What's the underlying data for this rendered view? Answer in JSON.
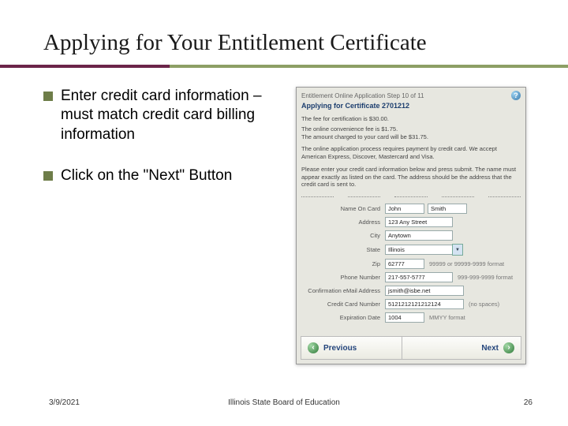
{
  "title": "Applying for Your Entitlement Certificate",
  "bullets": [
    "Enter credit card information – must match credit card billing information",
    "Click on the \"Next\" Button"
  ],
  "footer": {
    "date": "3/9/2021",
    "org": "Illinois State Board of Education",
    "page": "26"
  },
  "shot": {
    "step": "Entitlement Online Application Step 10 of 11",
    "heading": "Applying for Certificate 2701212",
    "fee1": "The fee for certification is $30.00.",
    "fee2": "The online convenience fee is $1.75.",
    "fee3": "The amount charged to your card will be $31.75.",
    "para1": "The online application process requires payment by credit card. We accept American Express, Discover, Mastercard and Visa.",
    "para2": "Please enter your credit card information below and press submit. The name must appear exactly as listed on the card. The address should be the address that the credit card is sent to.",
    "labels": {
      "name": "Name On Card",
      "address": "Address",
      "city": "City",
      "state": "State",
      "zip": "Zip",
      "phone": "Phone Number",
      "email": "Confirmation eMail Address",
      "card": "Credit Card Number",
      "exp": "Expiration Date"
    },
    "values": {
      "name_first": "John",
      "name_last": "Smith",
      "address": "123 Any Street",
      "city": "Anytown",
      "state": "Illinois",
      "zip": "62777",
      "phone": "217-557-5777",
      "email": "jsmith@isbe.net",
      "card": "5121212121212124",
      "exp": "1004"
    },
    "hints": {
      "zip": "99999 or 99999-9999 format",
      "phone": "999-999-9999 format",
      "card": "(no spaces)",
      "exp": "MMYY format"
    },
    "buttons": {
      "prev": "Previous",
      "next": "Next"
    }
  }
}
